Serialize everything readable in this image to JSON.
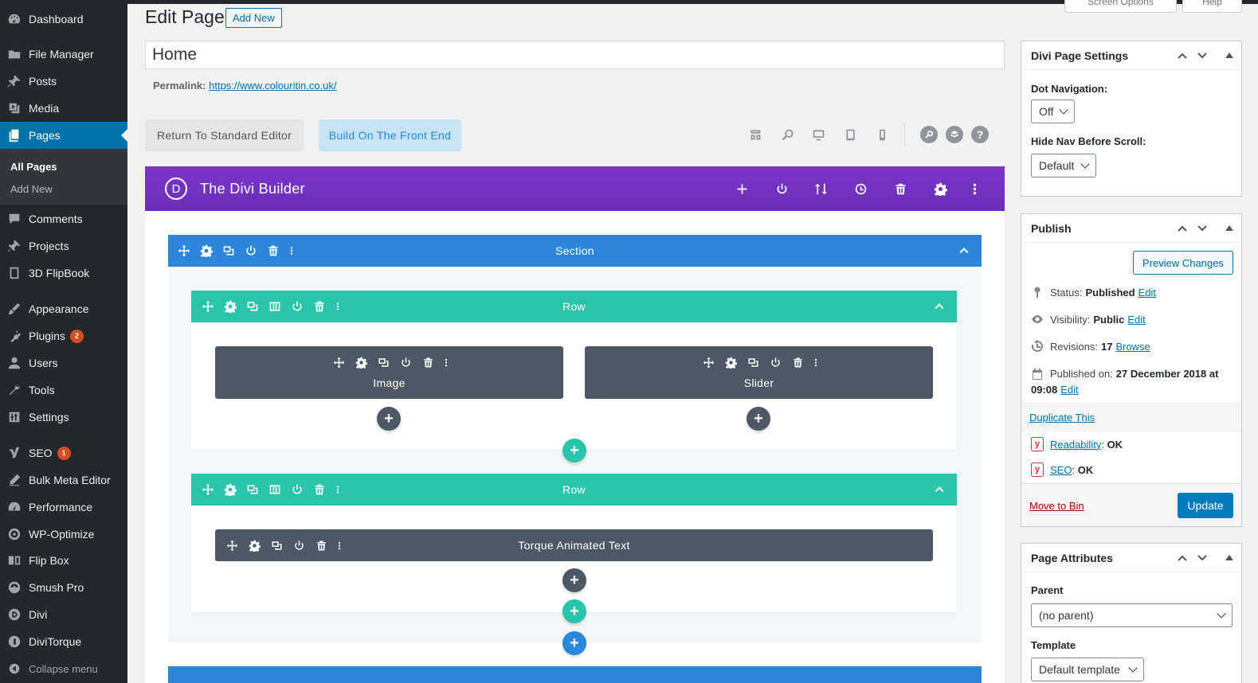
{
  "sidebar": {
    "items": [
      {
        "label": "Dashboard",
        "icon": "dashboard-icon"
      },
      {
        "label": "File Manager",
        "icon": "folder-icon"
      },
      {
        "label": "Posts",
        "icon": "pin-icon"
      },
      {
        "label": "Media",
        "icon": "media-icon"
      },
      {
        "label": "Pages",
        "icon": "pages-icon"
      },
      {
        "label": "Comments",
        "icon": "comments-icon"
      },
      {
        "label": "Projects",
        "icon": "pin-icon"
      },
      {
        "label": "3D FlipBook",
        "icon": "book-icon"
      },
      {
        "label": "Appearance",
        "icon": "brush-icon"
      },
      {
        "label": "Plugins",
        "icon": "plugin-icon",
        "badge": "2"
      },
      {
        "label": "Users",
        "icon": "user-icon"
      },
      {
        "label": "Tools",
        "icon": "wrench-icon"
      },
      {
        "label": "Settings",
        "icon": "settings-icon"
      },
      {
        "label": "SEO",
        "icon": "yoast-icon",
        "badge": "1"
      },
      {
        "label": "Bulk Meta Editor",
        "icon": "pencil-icon"
      },
      {
        "label": "Performance",
        "icon": "gauge-icon"
      },
      {
        "label": "WP-Optimize",
        "icon": "optimize-icon"
      },
      {
        "label": "Flip Box",
        "icon": "flipbox-icon"
      },
      {
        "label": "Smush Pro",
        "icon": "smush-icon"
      },
      {
        "label": "Divi",
        "icon": "divi-icon"
      },
      {
        "label": "DiviTorque",
        "icon": "torque-icon"
      }
    ],
    "submenu": {
      "all_pages": "All Pages",
      "add_new": "Add New"
    },
    "collapse": "Collapse menu"
  },
  "header": {
    "title": "Edit Page",
    "add_new": "Add New",
    "screen_options": "Screen Options",
    "help": "Help",
    "page_title_value": "Home",
    "permalink_label": "Permalink:",
    "permalink_url": "https://www.colouritin.co.uk/"
  },
  "builder_toolbar": {
    "return_label": "Return To Standard Editor",
    "front_label": "Build On The Front End"
  },
  "builder": {
    "logo": "D",
    "title": "The Divi Builder",
    "section_label": "Section",
    "rows": [
      {
        "label": "Row",
        "modules": [
          "Image",
          "Slider"
        ]
      },
      {
        "label": "Row",
        "modules": [
          "Torque Animated Text"
        ]
      }
    ],
    "add_symbol": "+"
  },
  "divi_settings": {
    "title": "Divi Page Settings",
    "dot_nav_label": "Dot Navigation:",
    "dot_nav_value": "Off",
    "hide_nav_label": "Hide Nav Before Scroll:",
    "hide_nav_value": "Default"
  },
  "publish": {
    "title": "Publish",
    "preview": "Preview Changes",
    "status_label": "Status:",
    "status_value": "Published",
    "visibility_label": "Visibility:",
    "visibility_value": "Public",
    "revisions_label": "Revisions:",
    "revisions_value": "17",
    "browse": "Browse",
    "published_label": "Published on:",
    "published_value": "27 December 2018 at",
    "published_time": "09:08",
    "edit": "Edit",
    "duplicate": "Duplicate This",
    "readability": "Readability",
    "readability_value": "OK",
    "seo": "SEO",
    "seo_value": "OK",
    "move_to_bin": "Move to Bin",
    "update": "Update"
  },
  "page_attributes": {
    "title": "Page Attributes",
    "parent_label": "Parent",
    "parent_value": "(no parent)",
    "template_label": "Template",
    "template_value": "Default template"
  },
  "colors": {
    "sidebar_bg": "#23282d",
    "active_blue": "#0073aa",
    "divi_purple": "#7b35c8",
    "section_blue": "#2b87da",
    "row_teal": "#29c4a9",
    "module_gray": "#4c5866"
  }
}
